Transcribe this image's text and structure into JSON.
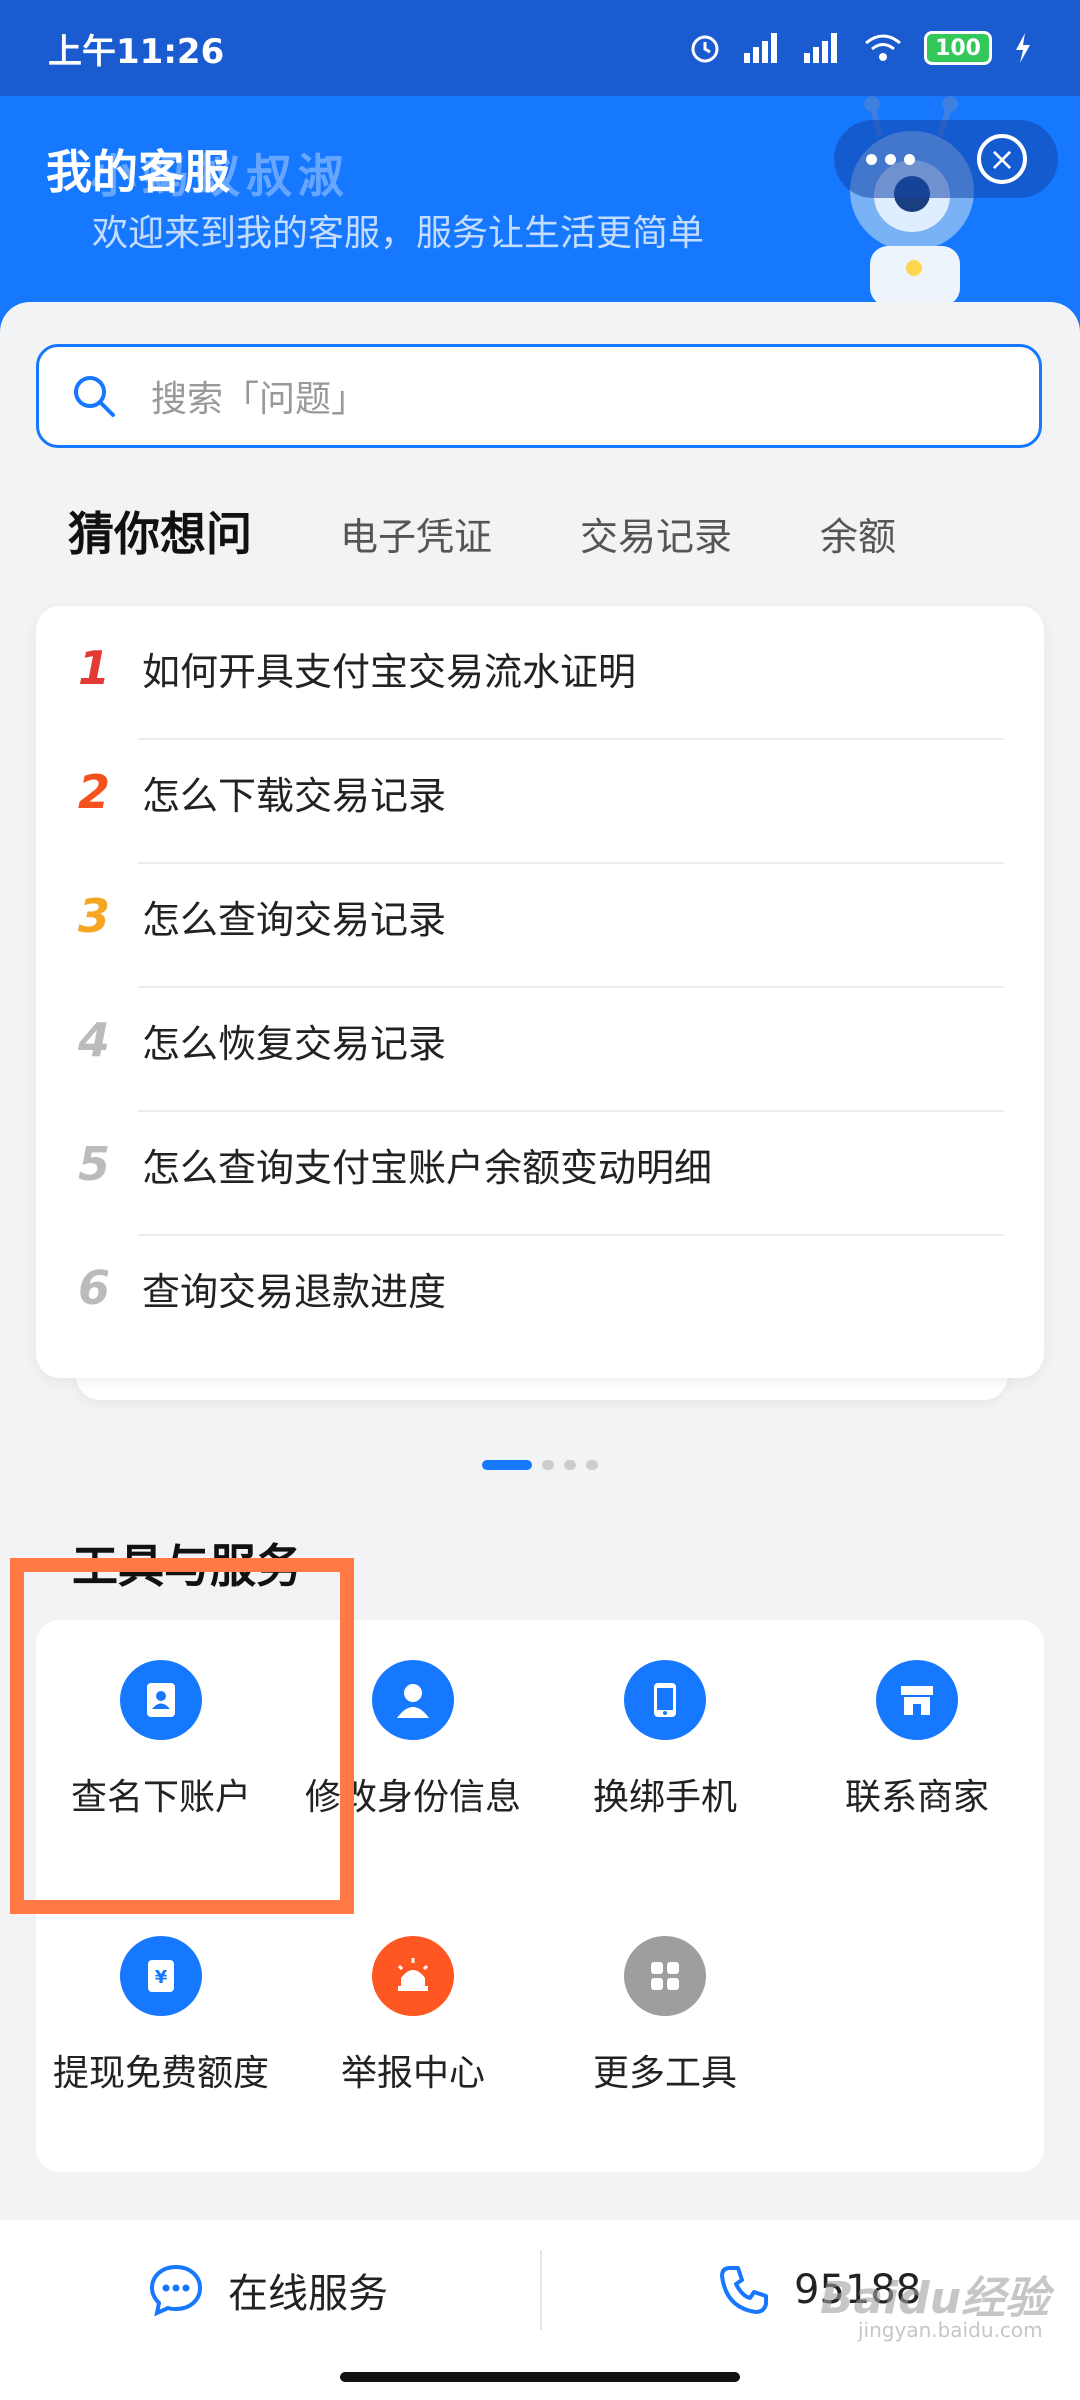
{
  "status_bar": {
    "time": "上午11:26",
    "battery": "100"
  },
  "header": {
    "title": "我的客服",
    "ghost_text": "小蚂蚁叔淑",
    "subtitle": "欢迎来到我的客服，服务让生活更简单"
  },
  "search": {
    "placeholder": "搜索「问题」"
  },
  "tabs": [
    {
      "label": "猜你想问",
      "active": true
    },
    {
      "label": "电子凭证",
      "active": false
    },
    {
      "label": "交易记录",
      "active": false
    },
    {
      "label": "余额",
      "active": false
    }
  ],
  "questions": [
    {
      "num": "1",
      "text": "如何开具支付宝交易流水证明",
      "color": "#e53935"
    },
    {
      "num": "2",
      "text": "怎么下载交易记录",
      "color": "#f4511e"
    },
    {
      "num": "3",
      "text": "怎么查询交易记录",
      "color": "#f5a623"
    },
    {
      "num": "4",
      "text": "怎么恢复交易记录",
      "color": "#bbbbbb"
    },
    {
      "num": "5",
      "text": "怎么查询支付宝账户余额变动明细",
      "color": "#bbbbbb"
    },
    {
      "num": "6",
      "text": "查询交易退款进度",
      "color": "#bbbbbb"
    }
  ],
  "tools": {
    "title": "工具与服务",
    "items": [
      {
        "label": "查名下账户",
        "icon": "contacts-book-icon",
        "color": "#1677ff"
      },
      {
        "label": "修改身份信息",
        "icon": "person-icon",
        "color": "#1677ff"
      },
      {
        "label": "换绑手机",
        "icon": "phone-icon",
        "color": "#1677ff"
      },
      {
        "label": "联系商家",
        "icon": "store-icon",
        "color": "#1677ff"
      },
      {
        "label": "提现免费额度",
        "icon": "yuan-card-icon",
        "color": "#1677ff"
      },
      {
        "label": "举报中心",
        "icon": "alarm-icon",
        "color": "#ff5722"
      },
      {
        "label": "更多工具",
        "icon": "grid-icon",
        "color": "#9e9e9e"
      }
    ]
  },
  "bottom": {
    "online_label": "在线服务",
    "phone_label": "95188"
  },
  "watermark": {
    "main": "Baidu经验",
    "sub": "jingyan.baidu.com"
  },
  "colors": {
    "brand": "#1677ff",
    "highlight": "#ff7a45"
  }
}
